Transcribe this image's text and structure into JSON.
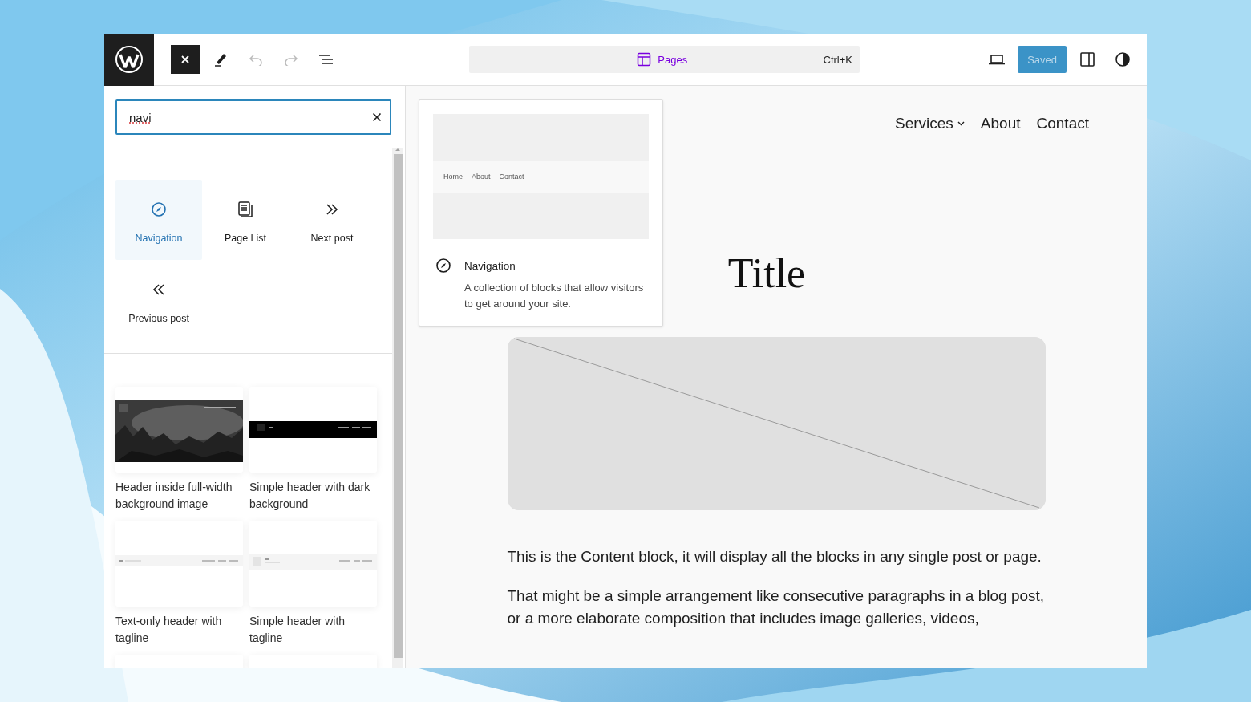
{
  "toolbar": {
    "undo": {
      "disabled": true
    },
    "redo": {
      "disabled": true
    },
    "command_bar": {
      "label": "Pages",
      "shortcut": "Ctrl+K"
    },
    "save_button": {
      "label": "Saved",
      "disabled": true
    }
  },
  "search": {
    "value": "navi"
  },
  "blocks": [
    {
      "label": "Navigation",
      "kind": "compass",
      "selected": true
    },
    {
      "label": "Page List",
      "kind": "page-list",
      "selected": false
    },
    {
      "label": "Next post",
      "kind": "next",
      "selected": false
    },
    {
      "label": "Previous post",
      "kind": "previous",
      "selected": false
    }
  ],
  "patterns": [
    {
      "label": "Header inside full-width background image"
    },
    {
      "label": "Simple header with dark background",
      "kind": "dark"
    },
    {
      "label": "Text-only header with tagline",
      "kind": "text-only"
    },
    {
      "label": "Simple header with tagline",
      "kind": "tagline"
    }
  ],
  "preview": {
    "nav_items": [
      "Home",
      "About",
      "Contact"
    ],
    "title": "Navigation",
    "description": "A collection of blocks that allow visitors to get around your site."
  },
  "canvas": {
    "nav": [
      {
        "label": "Services",
        "has_submenu": true
      },
      {
        "label": "About",
        "has_submenu": false
      },
      {
        "label": "Contact",
        "has_submenu": false
      }
    ],
    "title": "Title",
    "paragraphs": [
      "This is the Content block, it will display all the blocks in any single post or page.",
      "That might be a simple arrangement like consecutive paragraphs in a blog post, or a more elaborate composition that includes image galleries, videos,"
    ]
  }
}
